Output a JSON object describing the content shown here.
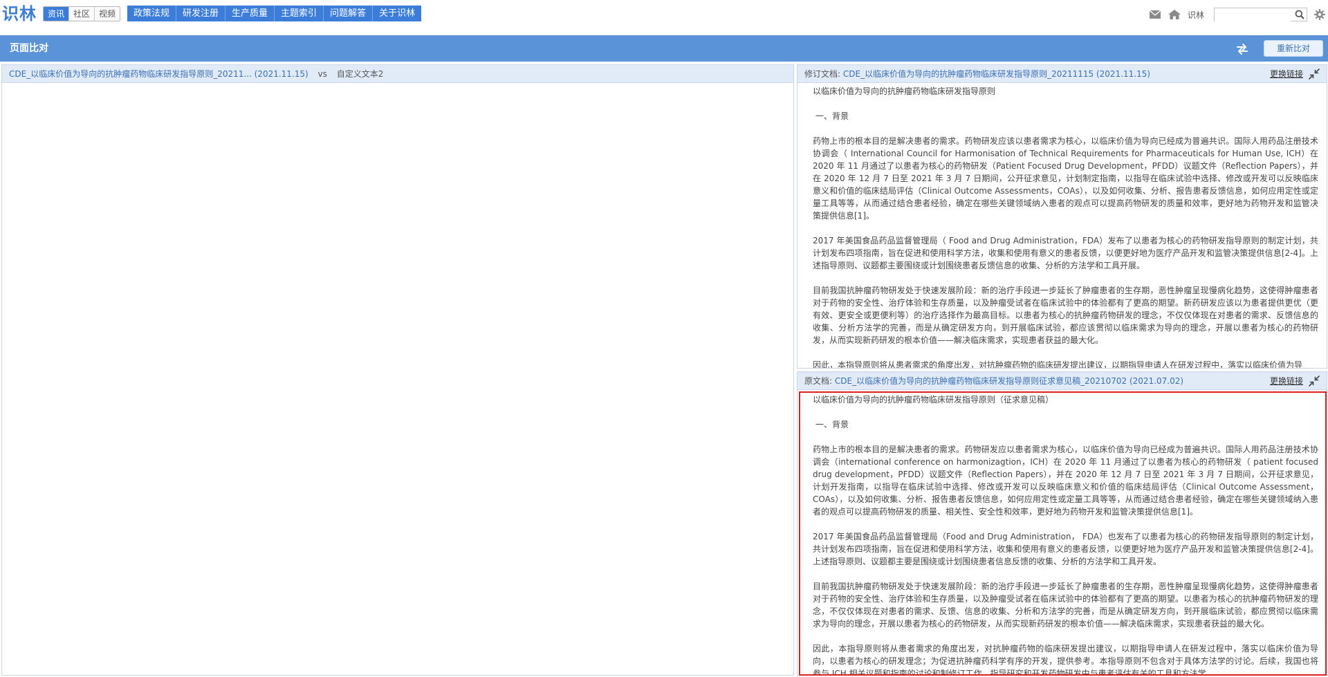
{
  "header": {
    "logo": "识林",
    "segments": [
      "资讯",
      "社区",
      "视频"
    ],
    "nav": [
      "政策法规",
      "研发注册",
      "生产质量",
      "主题索引",
      "问题解答",
      "关于识林"
    ],
    "user_label": "识林",
    "search_placeholder": "",
    "icons": [
      "mail-icon",
      "home-icon",
      "search-icon",
      "gear-icon"
    ]
  },
  "titlebar": {
    "title": "页面比对",
    "recompare_label": "重新比对"
  },
  "left_panel": {
    "doc_link": "CDE_以临床价值为导向的抗肿瘤药物临床研发指导原则_20211... (2021.11.15)",
    "vs": "vs",
    "other": "自定义文本2"
  },
  "collapse_label": "收起",
  "revised_panel": {
    "label": "修订文档:",
    "doc_link": "CDE_以临床价值为导向的抗肿瘤药物临床研发指导原则_20211115 (2021.11.15)",
    "replace_label": "更换链接",
    "title": "以临床价值为导向的抗肿瘤药物临床研发指导原则",
    "section": "一、背景",
    "paragraphs": [
      "药物上市的根本目的是解决患者的需求。药物研发应该以患者需求为核心，以临床价值为导向已经成为普遍共识。国际人用药品注册技术协调会（ International Council for Harmonisation of Technical Requirements for Pharmaceuticals for Human Use, ICH）在 2020 年 11 月通过了以患者为核心的药物研发（Patient Focused Drug Development，PFDD）议题文件（Reflection Papers），并在 2020 年 12 月 7 日至 2021 年 3 月 7 日期间，公开征求意见，计划制定指南，以指导在临床试验中选择、修改或开发可以反映临床意义和价值的临床结局评估（Clinical Outcome Assessments，COAs），以及如何收集、分析、报告患者反馈信息，如何应用定性或定量工具等等，从而通过结合患者经验，确定在哪些关键领域纳入患者的观点可以提高药物研发的质量和效率，更好地为药物开发和监管决策提供信息[1]。",
      "2017 年美国食品药品监督管理局（ Food and Drug Administration，FDA）发布了以患者为核心的药物研发指导原则的制定计划，共计划发布四项指南，旨在促进和使用科学方法，收集和使用有意义的患者反馈，以便更好地为医疗产品开发和监管决策提供信息[2-4]。上述指导原则、议题都主要围绕或计划围绕患者反馈信息的收集、分析的方法学和工具开展。",
      "目前我国抗肿瘤药物研发处于快速发展阶段：新的治疗手段进一步延长了肿瘤患者的生存期，恶性肿瘤呈现慢病化趋势，这使得肿瘤患者对于药物的安全性、治疗体验和生存质量，以及肿瘤受试者在临床试验中的体验都有了更高的期望。新药研发应该以为患者提供更优（更有效、更安全或更便利等）的治疗选择作为最高目标。以患者为核心的抗肿瘤药物研发的理念，不仅仅体现在对患者的需求、反馈信息的收集、分析方法学的完善，而是从确定研发方向，到开展临床试验，都应该贯彻以临床需求为导向的理念，开展以患者为核心的药物研发，从而实现新药研发的根本价值——解决临床需求，实现患者获益的最大化。",
      "因此，本指导原则将从患者需求的角度出发，对抗肿瘤药物的临床研发提出建议，以期指导申请人在研发过程中，落实以临床价值为导"
    ]
  },
  "original_panel": {
    "label": "原文档:",
    "doc_link": "CDE_以临床价值为导向的抗肿瘤药物临床研发指导原则征求意见稿_20210702 (2021.07.02)",
    "replace_label": "更换链接",
    "title": "以临床价值为导向的抗肿瘤药物临床研发指导原则（征求意见稿）",
    "section": "一、背景",
    "paragraphs": [
      "药物上市的根本目的是解决患者的需求。药物研发应以患者需求为核心，以临床价值为导向已经成为普遍共识。国际人用药品注册技术协调会（international conference on harmonizagtion，ICH）在 2020 年 11 月通过了以患者为核心的药物研发（ patient focused drug development，PFDD）议题文件（Reflection Papers），并在 2020 年 12 月 7 日至 2021 年 3 月 7 日期间，公开征求意见，计划开发指南，以指导在临床试验中选择、修改或开发可以反映临床意义和价值的临床结局评估（Clinical Outcome Assessment，COAs），以及如何收集、分析、报告患者反馈信息，如何应用定性或定量工具等等，从而通过结合患者经验，确定在哪些关键领域纳入患者的观点可以提高药物研发的质量、相关性、安全性和效率，更好地为药物开发和监管决策提供信息[1]。",
      "2017 年美国食品药品监督管理局（Food and Drug Administration， FDA）也发布了以患者为核心的药物研发指导原则的制定计划，共计划发布四项指南，旨在促进和使用科学方法，收集和使用有意义的患者反馈，以便更好地为医疗产品开发和监管决策提供信息[2-4]。上述指导原则、议题都主要是围绕或计划围绕患者信息反馈的收集、分析的方法学和工具开发。",
      "目前我国抗肿瘤药物研发处于快速发展阶段：新的治疗手段进一步延长了肿瘤患者的生存期，恶性肿瘤呈现慢病化趋势，这使得肿瘤患者对于药物的安全性、治疗体验和生存质量，以及肿瘤受试者在临床试验中的体验都有了更高的期望。以患者为核心的抗肿瘤药物研发的理念，不仅仅体现在对患者的需求、反馈、信息的收集、分析和方法学的完善，而是从确定研发方向，到开展临床试验，都应贯彻以临床需求为导向的理念，开展以患者为核心的药物研发，从而实现新药研发的根本价值——解决临床需求，实现患者获益的最大化。",
      "因此，本指导原则将从患者需求的角度出发，对抗肿瘤药物的临床研发提出建议，以期指导申请人在研发过程中，落实以临床价值为导向，以患者为核心的研发理念；为促进抗肿瘤药科学有序的开发，提供参考。本指导原则不包含对于具体方法学的讨论。后续，我国也将参与 ICH 相关议题和指南的讨论和制修订工作，指导研究和开发药物研发中与患者评估有关的工具和方法学。"
    ]
  }
}
